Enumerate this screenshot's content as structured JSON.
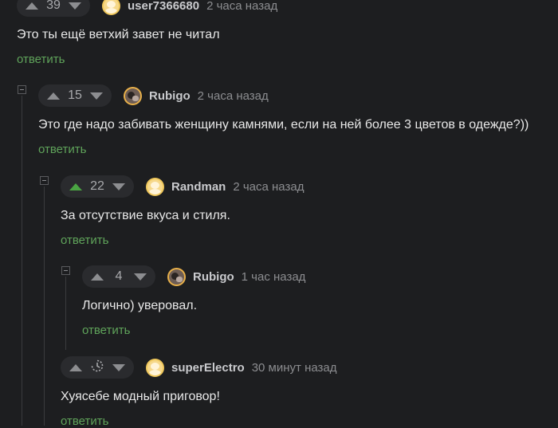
{
  "colors": {
    "background": "#1d1e20",
    "rating_pill": "#2a2b2e",
    "reply_link": "#5fa35a",
    "upvote_active": "#4aa443",
    "thread_line": "#3a3b3e"
  },
  "comments": [
    {
      "rating": "39",
      "user": "user7366680",
      "time": "2 часа назад",
      "text": "Это ты ещё ветхий завет не читал",
      "reply": "ответить",
      "avatar": "default-avatar-icon",
      "upvoted": false
    },
    {
      "rating": "15",
      "user": "Rubigo",
      "time": "2 часа назад",
      "text": "Это где надо забивать женщину камнями, если на ней более 3 цветов в одежде?))",
      "reply": "ответить",
      "avatar": "rubigo-avatar-icon",
      "upvoted": false
    },
    {
      "rating": "22",
      "user": "Randman",
      "time": "2 часа назад",
      "text": "За отсутствие вкуса и стиля.",
      "reply": "ответить",
      "avatar": "default-avatar-icon",
      "upvoted": true
    },
    {
      "rating": "4",
      "user": "Rubigo",
      "time": "1 час назад",
      "text": "Логично) уверовал.",
      "reply": "ответить",
      "avatar": "rubigo-avatar-icon",
      "upvoted": false
    },
    {
      "rating_icon": "clock-icon",
      "user": "superElectro",
      "time": "30 минут назад",
      "text": "Хуясебе модный приговор!",
      "reply": "ответить",
      "avatar": "default-avatar-icon",
      "upvoted": false
    }
  ]
}
